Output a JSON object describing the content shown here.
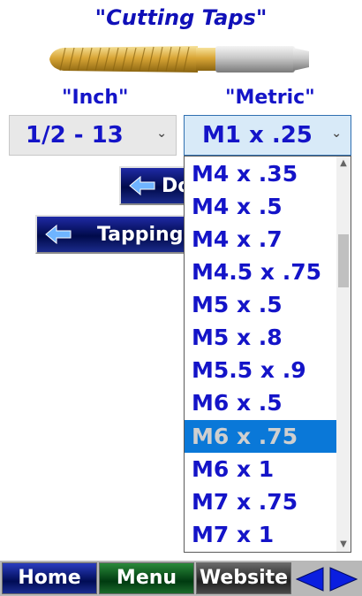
{
  "title": "\"Cutting Taps\"",
  "inch": {
    "label": "\"Inch\"",
    "selected": "1/2 - 13"
  },
  "metric": {
    "label": "\"Metric\"",
    "selected": "M1 x .25",
    "options": [
      "M4 x .35",
      "M4 x .5",
      "M4 x .7",
      "M4.5 x .75",
      "M5 x .5",
      "M5 x .8",
      "M5.5 x .9",
      "M6 x .5",
      "M6 x .75",
      "M6 x 1",
      "M7 x .75",
      "M7 x 1"
    ],
    "highlighted": "M6 x .75"
  },
  "buttons": {
    "drill_partial": "Do",
    "tapping_partial": "Tapping"
  },
  "nav": {
    "home": "Home",
    "menu": "Menu",
    "website": "Website"
  },
  "colors": {
    "accent_text": "#1414c8",
    "highlight": "#0a78d8"
  }
}
